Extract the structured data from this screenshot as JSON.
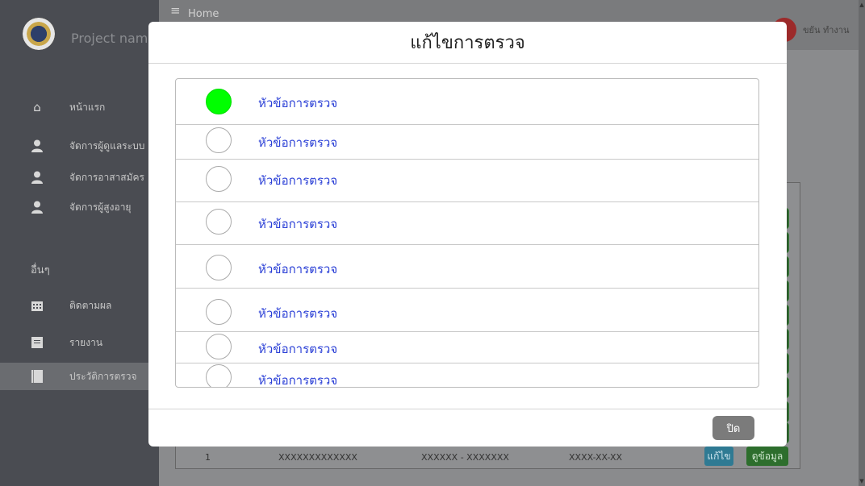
{
  "app": {
    "project_name": "Project name",
    "breadcrumb": "Home",
    "user_name": "ขยัน ทำงาน",
    "menu_icon": "hamburger-icon"
  },
  "sidebar": {
    "items": [
      {
        "label": "หน้าแรก",
        "icon": "home-icon"
      },
      {
        "label": "จัดการผู้ดูแลระบบ",
        "icon": "user-icon"
      },
      {
        "label": "จัดการอาสาสมัคร",
        "icon": "user-icon"
      },
      {
        "label": "จัดการผู้สูงอายุ",
        "icon": "user-icon"
      }
    ],
    "section_label": "อื่นๆ",
    "other_items": [
      {
        "label": "ติดตามผล",
        "icon": "calendar-icon"
      },
      {
        "label": "รายงาน",
        "icon": "document-icon"
      },
      {
        "label": "ประวัติการตรวจ",
        "icon": "book-icon",
        "active": true
      }
    ]
  },
  "table": {
    "row": {
      "number": "1",
      "code": "XXXXXXXXXXXXX",
      "range": "XXXXXX - XXXXXXX",
      "date": "XXXX-XX-XX",
      "edit_label": "แก้ไข",
      "view_label": "ดูข้อมูล"
    }
  },
  "modal": {
    "title": "แก้ไขการตรวจ",
    "items": [
      {
        "label": "หัวข้อการตรวจ",
        "checked": true
      },
      {
        "label": "หัวข้อการตรวจ",
        "checked": false
      },
      {
        "label": "หัวข้อการตรวจ",
        "checked": false
      },
      {
        "label": "หัวข้อการตรวจ",
        "checked": false
      },
      {
        "label": "หัวข้อการตรวจ",
        "checked": false
      },
      {
        "label": "หัวข้อการตรวจ",
        "checked": false
      },
      {
        "label": "หัวข้อการตรวจ",
        "checked": false
      },
      {
        "label": "หัวข้อการตรวจ",
        "checked": false
      }
    ],
    "close_label": "ปิด"
  },
  "colors": {
    "checked": "#00ff00",
    "label": "#2a3fd6",
    "close_button": "#7b7b7b"
  }
}
